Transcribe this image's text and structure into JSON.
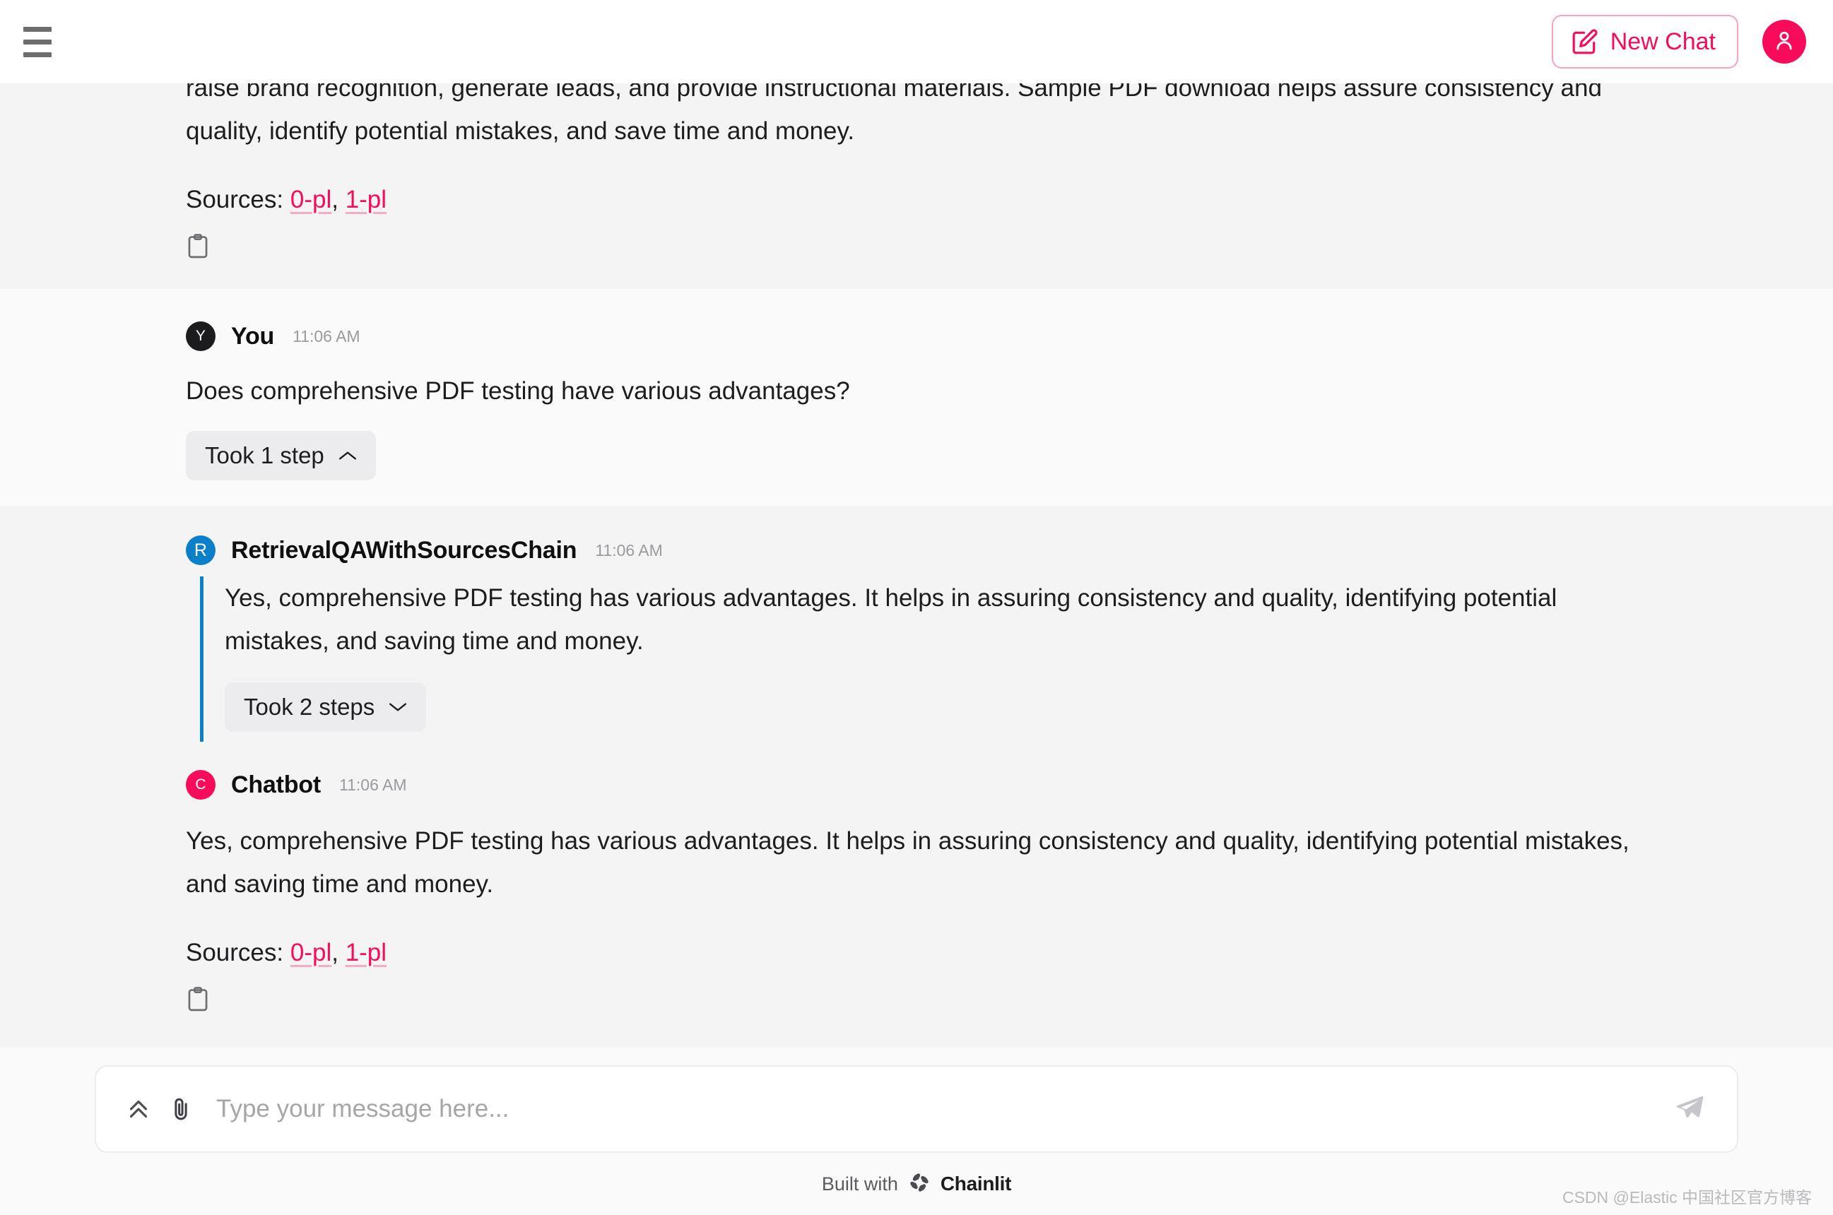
{
  "header": {
    "menu_icon": "hamburger-menu-icon",
    "new_chat_label": "New Chat",
    "new_chat_icon": "edit-square-icon",
    "user_avatar_icon": "user-icon",
    "accent_color": "#f80b5a",
    "accent_border_color": "#fba0bf"
  },
  "conversation": {
    "clipped_message": {
      "text": "raise brand recognition, generate leads, and provide instructional materials. Sample PDF download helps assure consistency and quality, identify potential mistakes, and save time and money.",
      "sources_label": "Sources:",
      "sources": [
        "0-pl",
        "1-pl"
      ],
      "sources_separator": ", ",
      "copy_icon": "clipboard-copy-icon"
    },
    "user_message": {
      "avatar_initial": "Y",
      "avatar_color": "#1c1c1e",
      "author": "You",
      "time": "11:06 AM",
      "text": "Does comprehensive PDF testing have various advantages?",
      "step_chip_label": "Took 1 step",
      "step_chip_state": "expanded",
      "step_chip_icon": "chevron-up-icon"
    },
    "retrieval_message": {
      "avatar_initial": "R",
      "avatar_color": "#0b7fc7",
      "author": "RetrievalQAWithSourcesChain",
      "time": "11:06 AM",
      "text": "Yes, comprehensive PDF testing has various advantages. It helps in assuring consistency and quality, identifying potential mistakes, and saving time and money.",
      "step_chip_label": "Took 2 steps",
      "step_chip_state": "collapsed",
      "step_chip_icon": "chevron-down-icon",
      "accent_line_color": "#0b7fc7"
    },
    "chatbot_message": {
      "avatar_initial": "C",
      "avatar_color": "#f80b5a",
      "author": "Chatbot",
      "time": "11:06 AM",
      "text": "Yes, comprehensive PDF testing has various advantages. It helps in assuring consistency and quality, identifying potential mistakes, and saving time and money.",
      "sources_label": "Sources:",
      "sources": [
        "0-pl",
        "1-pl"
      ],
      "sources_separator": ", ",
      "copy_icon": "clipboard-copy-icon"
    }
  },
  "composer": {
    "expand_icon": "double-chevron-up-icon",
    "attach_icon": "paperclip-icon",
    "placeholder": "Type your message here...",
    "value": "",
    "send_icon": "send-plane-icon"
  },
  "footer": {
    "built_with": "Built with",
    "brand": "Chainlit",
    "logo_icon": "chainlit-logo-icon"
  },
  "watermark": {
    "text": "CSDN @Elastic 中国社区官方博客"
  }
}
